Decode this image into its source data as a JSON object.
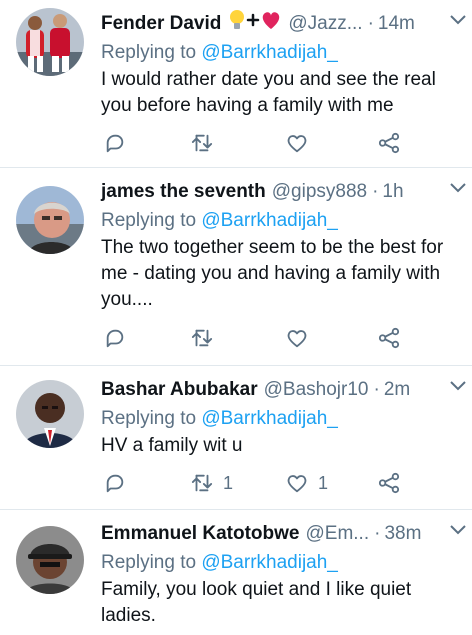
{
  "tweets": [
    {
      "name": "Fender David",
      "name_emoji": "💡+❤️",
      "handle": "@Jazz...",
      "time": "14m",
      "reply_prefix": "Replying to",
      "reply_to": "@Barrkhadijah_",
      "text": "I would rather date you and see the real you before having a family with me",
      "retweets": "",
      "likes": "",
      "avatar": "arsenal-players-avatar"
    },
    {
      "name": "james the seventh",
      "handle": "@gipsy888",
      "time": "1h",
      "reply_prefix": "Replying to",
      "reply_to": "@Barrkhadijah_",
      "text": "The two together seem to be the best for me - dating you and having a family with you....",
      "retweets": "",
      "likes": "",
      "avatar": "older-man-avatar"
    },
    {
      "name": "Bashar Abubakar",
      "handle": "@Bashojr10",
      "time": "2m",
      "reply_prefix": "Replying to",
      "reply_to": "@Barrkhadijah_",
      "text": "HV a family wit u",
      "retweets": "1",
      "likes": "1",
      "avatar": "man-in-suit-avatar"
    },
    {
      "name": "Emmanuel Katotobwe",
      "handle": "@Em...",
      "time": "38m",
      "reply_prefix": "Replying to",
      "reply_to": "@Barrkhadijah_",
      "text": "Family, you look quiet and I like quiet ladies.",
      "retweets": "",
      "likes": "",
      "avatar": "man-with-cap-avatar"
    }
  ],
  "colors": {
    "text": "#0f1419",
    "secondary": "#5b7083",
    "mention": "#1da1f2",
    "divider": "#e1e8ed"
  }
}
